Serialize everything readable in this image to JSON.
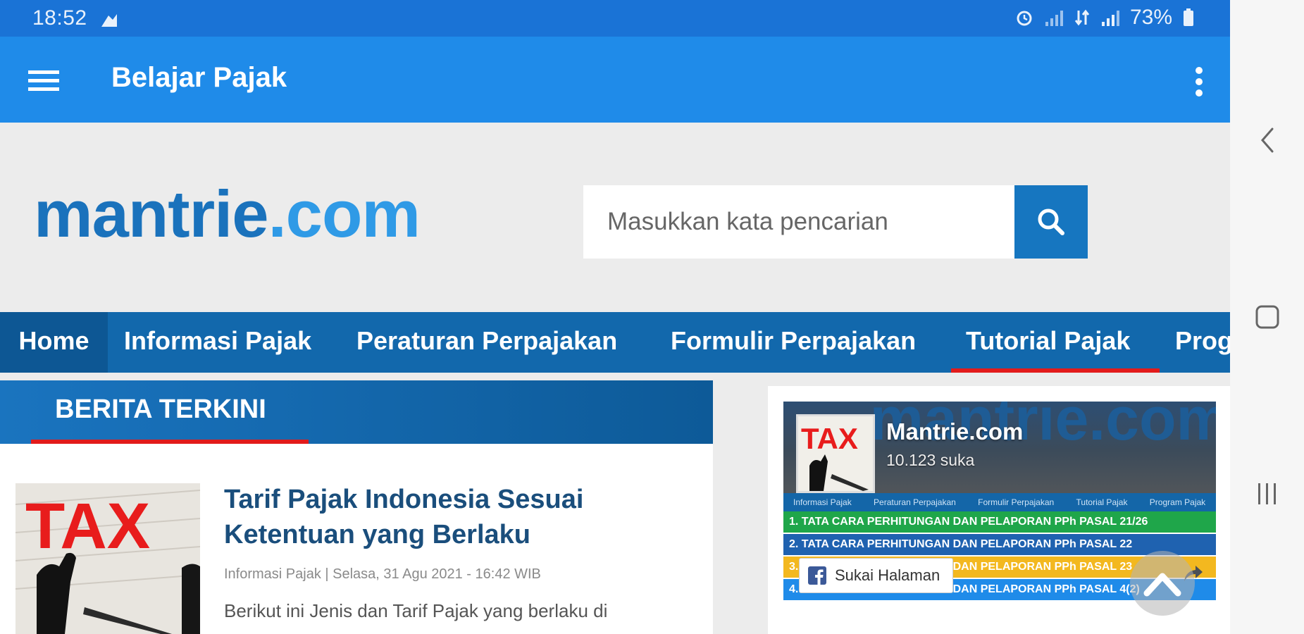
{
  "status_bar": {
    "time": "18:52",
    "battery": "73%"
  },
  "app_bar": {
    "title": "Belajar Pajak"
  },
  "site": {
    "logo_part1": "mantrie",
    "logo_part2": ".com",
    "search_placeholder": "Masukkan kata pencarian"
  },
  "nav": {
    "items": [
      {
        "label": "Home"
      },
      {
        "label": "Informasi Pajak"
      },
      {
        "label": "Peraturan Perpajakan"
      },
      {
        "label": "Formulir Perpajakan"
      },
      {
        "label": "Tutorial Pajak"
      },
      {
        "label": "Prog"
      }
    ],
    "active_index": 4
  },
  "section": {
    "title": "BERITA TERKINI"
  },
  "article": {
    "title": "Tarif Pajak Indonesia Sesuai Ketentuan yang Berlaku",
    "meta": "Informasi Pajak | Selasa, 31 Agu 2021 - 16:42 WIB",
    "excerpt": "Berikut ini Jenis dan Tarif Pajak yang berlaku di",
    "thumb_text": "TAX"
  },
  "facebook": {
    "page_name": "Mantrie.com",
    "likes": "10.123 suka",
    "cover_text": "mantrie.com",
    "profile_text": "TAX",
    "like_button": "Sukai Halaman",
    "strip_items": [
      "Informasi Pajak",
      "Peraturan Perpajakan",
      "Formulir Perpajakan",
      "Tutorial Pajak",
      "Program Pajak"
    ],
    "list_rows": [
      "1.  TATA CARA PERHITUNGAN DAN PELAPORAN PPh  PASAL 21/26",
      "2.  TATA CARA PERHITUNGAN DAN PELAPORAN PPh PASAL 22",
      "3.  TATA CARA PERHITUNGAN DAN PELAPORAN PPh PASAL 23",
      "4.  TATA CARA PERHITUNGAN DAN PELAPORAN PPh PASAL 4(2)"
    ]
  },
  "colors": {
    "status_bar": "#1a73d6",
    "app_bar": "#1f8be9",
    "nav": "#1268ac",
    "accent_red": "#e21b1b",
    "row_colors": [
      "#1fa64a",
      "#1f62b0",
      "#f3b81f",
      "#1f8be9"
    ]
  },
  "icons": {
    "menu": "hamburger-icon",
    "overflow": "more-vertical-icon",
    "search": "search-icon",
    "back": "chevron-left-icon",
    "home": "square-icon",
    "recents": "recents-icon",
    "scroll_top": "chevron-up-icon",
    "share": "share-icon",
    "facebook": "facebook-icon"
  }
}
